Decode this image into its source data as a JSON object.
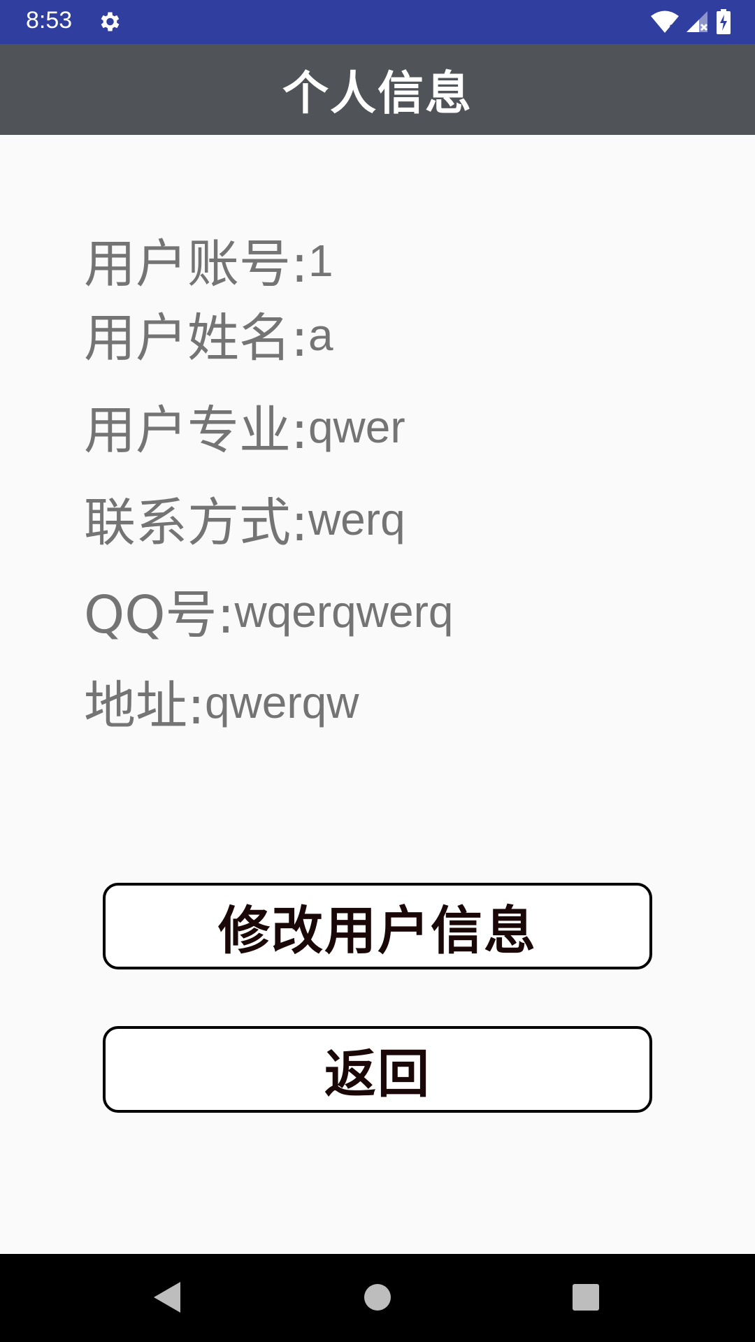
{
  "status_bar": {
    "time": "8:53"
  },
  "header": {
    "title": "个人信息"
  },
  "info": [
    {
      "label": "用户账号:",
      "value": "1"
    },
    {
      "label": "用户姓名:",
      "value": "a"
    },
    {
      "label": "用户专业:",
      "value": "qwer"
    },
    {
      "label": "联系方式:",
      "value": "werq"
    },
    {
      "label": "QQ号:",
      "value": "wqerqwerq"
    },
    {
      "label": "地址:",
      "value": "qwerqw"
    }
  ],
  "buttons": {
    "edit": "修改用户信息",
    "back": "返回"
  },
  "colors": {
    "status_bar": "#303f9f",
    "app_bar": "#505459",
    "background": "#fafafa",
    "info_text": "#747474",
    "button_text": "#1a0808"
  }
}
